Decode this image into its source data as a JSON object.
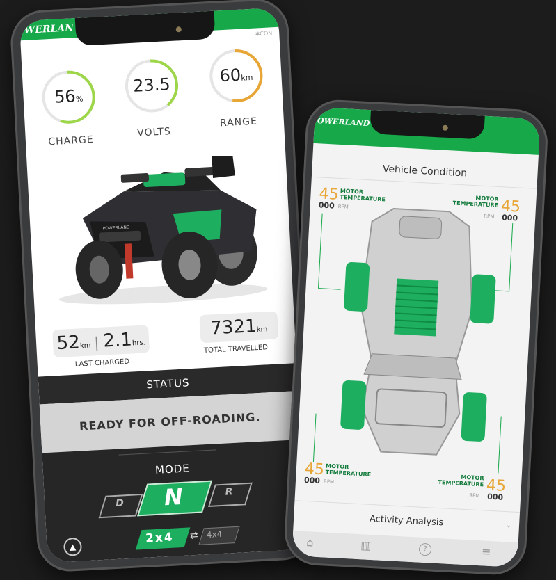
{
  "phone1": {
    "brand": "WERLAN",
    "bluetooth": "CON",
    "gauges": [
      {
        "value": "56",
        "unit": "%",
        "label": "CHARGE"
      },
      {
        "value": "23.5",
        "unit": "",
        "label": "VOLTS"
      },
      {
        "value": "60",
        "unit": "km",
        "label": "RANGE"
      }
    ],
    "last_charged": {
      "km": "52",
      "km_unit": "km",
      "hrs": "2.1",
      "hrs_unit": "hrs.",
      "label": "LAST CHARGED"
    },
    "total": {
      "value": "7321",
      "unit": "km",
      "label": "TOTAL TRAVELLED"
    },
    "status_header": "STATUS",
    "status_text": "READY FOR OFF-ROADING.",
    "mode_label": "MODE",
    "modes": {
      "d": "D",
      "n": "N",
      "r": "R"
    },
    "drive": {
      "active": "2x4",
      "inactive": "4x4",
      "swap": "⇄"
    },
    "vehicle_logo": "POWERLAND"
  },
  "phone2": {
    "brand": "OWERLAND",
    "title": "Vehicle Condition",
    "temps": [
      {
        "pos": "tl",
        "value": "45",
        "zeros": "000",
        "label1": "MOTOR",
        "label2": "TEMPERATURE",
        "rpm": "RPM"
      },
      {
        "pos": "tr",
        "value": "45",
        "zeros": "000",
        "label1": "MOTOR",
        "label2": "TEMPERATURE",
        "rpm": "RPM"
      },
      {
        "pos": "bl",
        "value": "45",
        "zeros": "000",
        "label1": "MOTOR",
        "label2": "TEMPERATURE",
        "rpm": "RPM"
      },
      {
        "pos": "br",
        "value": "45",
        "zeros": "000",
        "label1": "MOTOR",
        "label2": "TEMPERATURE",
        "rpm": "RPM"
      }
    ],
    "activity_label": "Activity Analysis",
    "nav": [
      "home-icon",
      "chart-icon",
      "help-icon",
      "menu-icon"
    ]
  },
  "colors": {
    "accent": "#17a84a",
    "orange": "#e7a636",
    "charge_ring": "#9ed64a",
    "range_ring": "#e7a636"
  }
}
